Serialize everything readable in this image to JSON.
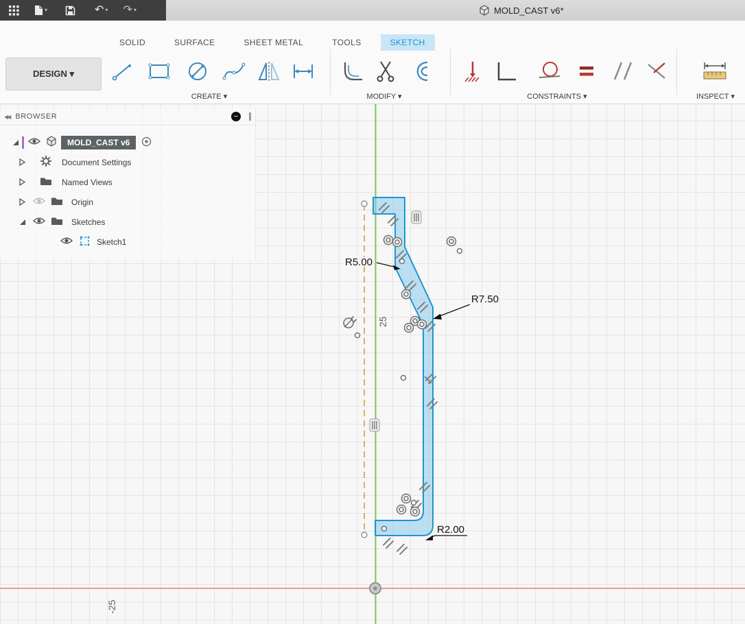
{
  "window": {
    "document_title": "MOLD_CAST v6*"
  },
  "toolbar": {
    "workspace_button_label": "DESIGN ▾",
    "icons": [
      "app-grid",
      "new-file",
      "save",
      "undo",
      "redo"
    ]
  },
  "ribbon": {
    "tabs": [
      {
        "label": "SOLID",
        "active": false
      },
      {
        "label": "SURFACE",
        "active": false
      },
      {
        "label": "SHEET METAL",
        "active": false
      },
      {
        "label": "TOOLS",
        "active": false
      },
      {
        "label": "SKETCH",
        "active": true
      }
    ],
    "groups": [
      {
        "label": "CREATE ▾",
        "tools": [
          "line",
          "rectangle",
          "circle",
          "spline",
          "mirror",
          "dimension"
        ]
      },
      {
        "label": "MODIFY ▾",
        "tools": [
          "fillet",
          "trim",
          "offset"
        ]
      },
      {
        "label": "CONSTRAINTS ▾",
        "tools": [
          "fix",
          "perpendicular",
          "tangent",
          "equal",
          "parallel",
          "symmetry"
        ]
      },
      {
        "label": "INSPECT ▾",
        "tools": [
          "measure"
        ]
      }
    ]
  },
  "browser": {
    "header_label": "BROWSER",
    "items": [
      {
        "label": "MOLD_CAST v6",
        "selected": true,
        "expanded": true
      },
      {
        "label": "Document Settings",
        "expanded": false
      },
      {
        "label": "Named Views",
        "expanded": false
      },
      {
        "label": "Origin",
        "expanded": false,
        "visibility": "hidden"
      },
      {
        "label": "Sketches",
        "expanded": true
      },
      {
        "label": "Sketch1",
        "type": "sketch"
      }
    ]
  },
  "canvas": {
    "dimension_labels": {
      "r5": "R5.00",
      "r7": "R7.50",
      "r2": "R2.00"
    },
    "axis_dim_labels": {
      "pos25": "25",
      "neg25": "-25"
    },
    "colors": {
      "sketch_stroke": "#1d95d3",
      "sketch_fill": "rgba(128,200,235,0.5)",
      "axis_y_green": "#7fc860",
      "axis_x_red": "#ef9a94",
      "construction_orange": "#d89a3e"
    }
  }
}
